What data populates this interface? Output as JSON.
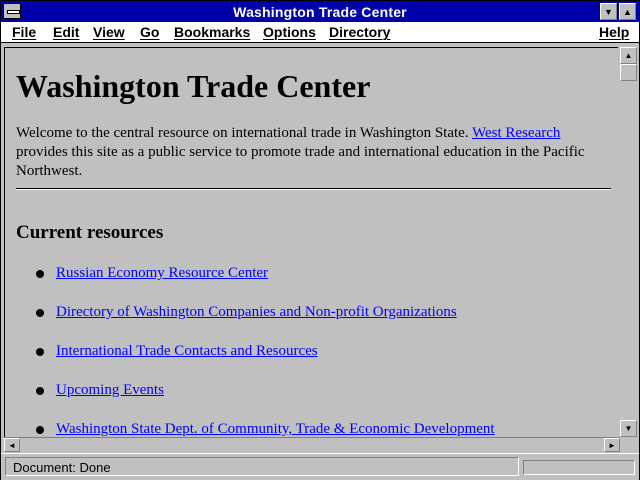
{
  "window": {
    "title": "Washington Trade Center"
  },
  "menu": {
    "items": [
      {
        "label": "File"
      },
      {
        "label": "Edit"
      },
      {
        "label": "View"
      },
      {
        "label": "Go"
      },
      {
        "label": "Bookmarks"
      },
      {
        "label": "Options"
      },
      {
        "label": "Directory"
      },
      {
        "label": "Help"
      }
    ]
  },
  "page": {
    "heading": "Washington Trade Center",
    "intro_before": "Welcome to the central resource on international trade in Washington State. ",
    "intro_link": "West Research",
    "intro_after": " provides this site as a public service to promote trade and international education in the Pacific Northwest.",
    "resources_heading": "Current resources",
    "resources": [
      {
        "label": "Russian Economy Resource Center"
      },
      {
        "label": "Directory of Washington Companies and Non-profit Organizations"
      },
      {
        "label": "International Trade Contacts and Resources"
      },
      {
        "label": "Upcoming Events"
      },
      {
        "label": "Washington State Dept. of Community, Trade & Economic Development"
      }
    ]
  },
  "status": {
    "text": "Document: Done"
  },
  "icons": {
    "system_menu": "system-menu-icon",
    "minimize": "minimize-arrow-icon",
    "maximize": "maximize-arrow-icon",
    "scroll_up": "arrow-up-icon",
    "scroll_down": "arrow-down-icon",
    "scroll_left": "arrow-left-icon",
    "scroll_right": "arrow-right-icon",
    "bullet": "bullet-icon"
  },
  "colors": {
    "titlebar": "#0000a8",
    "link": "#0000ff",
    "chrome": "#c0c0c0"
  }
}
